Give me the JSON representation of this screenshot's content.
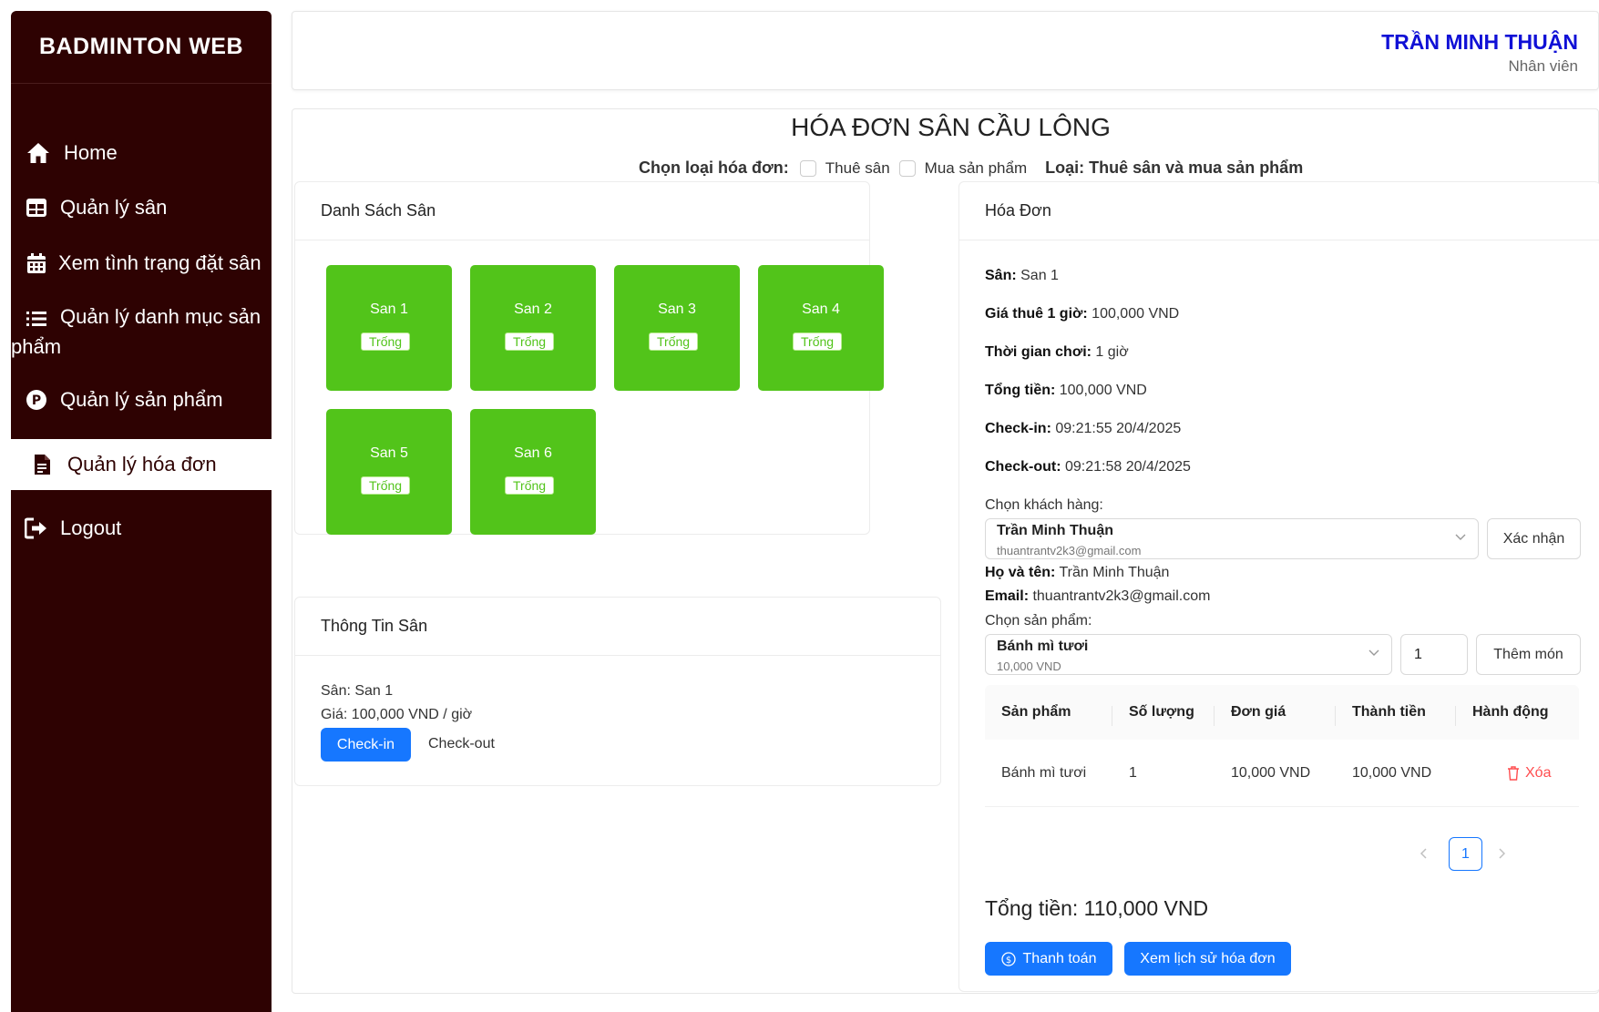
{
  "sidebar": {
    "brand": "BADMINTON WEB",
    "items": [
      {
        "label": "Home",
        "icon": "home-icon"
      },
      {
        "label": "Quản lý sân",
        "icon": "table-icon"
      },
      {
        "label": "Xem tình trạng đặt sân",
        "icon": "calendar-icon"
      },
      {
        "label_line1": "Quản lý danh mục sản",
        "label_line2": "phẩm",
        "icon": "list-icon"
      },
      {
        "label": "Quản lý sản phẩm",
        "icon": "product-icon"
      },
      {
        "label": "Quản lý hóa đơn",
        "icon": "invoice-icon",
        "active": true
      },
      {
        "label": "Logout",
        "icon": "logout-icon"
      }
    ]
  },
  "header": {
    "user_name": "TRẦN MINH THUẬN",
    "user_role": "Nhân viên"
  },
  "main": {
    "title": "HÓA ĐƠN SÂN CẦU LÔNG",
    "type_label": "Chọn loại hóa đơn:",
    "option_rent": "Thuê sân",
    "option_buy": "Mua sản phẩm",
    "type_value": "Loại: Thuê sân và mua sản phẩm"
  },
  "courts": {
    "title": "Danh Sách Sân",
    "status_color": "#52c41a",
    "list": [
      {
        "name": "San 1",
        "status": "Trống"
      },
      {
        "name": "San 2",
        "status": "Trống"
      },
      {
        "name": "San 3",
        "status": "Trống"
      },
      {
        "name": "San 4",
        "status": "Trống"
      },
      {
        "name": "San 5",
        "status": "Trống"
      },
      {
        "name": "San 6",
        "status": "Trống"
      }
    ]
  },
  "court_info": {
    "title": "Thông Tin Sân",
    "court_line": "Sân: San 1",
    "price_line": "Giá: 100,000 VND / giờ",
    "checkin_label": "Check-in",
    "checkout_label": "Check-out"
  },
  "invoice": {
    "title": "Hóa Đơn",
    "court_label": "Sân:",
    "court_value": " San 1",
    "price_label": "Giá thuê 1 giờ:",
    "price_value": " 100,000 VND",
    "time_label": "Thời gian chơi:",
    "time_value": " 1 giờ",
    "total_label": "Tổng tiền:",
    "total_value": " 100,000 VND",
    "checkin_label": "Check-in:",
    "checkin_value": " 09:21:55 20/4/2025",
    "checkout_label": "Check-out:",
    "checkout_value": " 09:21:58 20/4/2025",
    "customer_prompt": "Chọn khách hàng:",
    "customer_selected_name": "Trần Minh Thuận",
    "customer_selected_email": "thuantrantv2k3@gmail.com",
    "confirm_label": "Xác nhận",
    "fullname_label": "Họ và tên:",
    "fullname_value": " Trần Minh Thuận",
    "email_label": "Email:",
    "email_value": " thuantrantv2k3@gmail.com",
    "product_prompt": "Chọn sản phẩm:",
    "product_selected_name": "Bánh mì tươi",
    "product_selected_price": "10,000 VND",
    "quantity_value": "1",
    "add_label": "Thêm món",
    "table": {
      "headers": [
        "Sản phẩm",
        "Số lượng",
        "Đơn giá",
        "Thành tiền",
        "Hành động"
      ],
      "rows": [
        {
          "product": "Bánh mì tươi",
          "qty": "1",
          "unit_price": "10,000 VND",
          "amount": "10,000 VND",
          "action": "Xóa"
        }
      ]
    },
    "page_current": "1",
    "grand_total": "Tổng tiền: 110,000 VND",
    "pay_label": "Thanh toán",
    "history_label": "Xem lịch sử hóa đơn",
    "accent_color": "#1677ff",
    "danger_color": "#ff4d4f"
  }
}
